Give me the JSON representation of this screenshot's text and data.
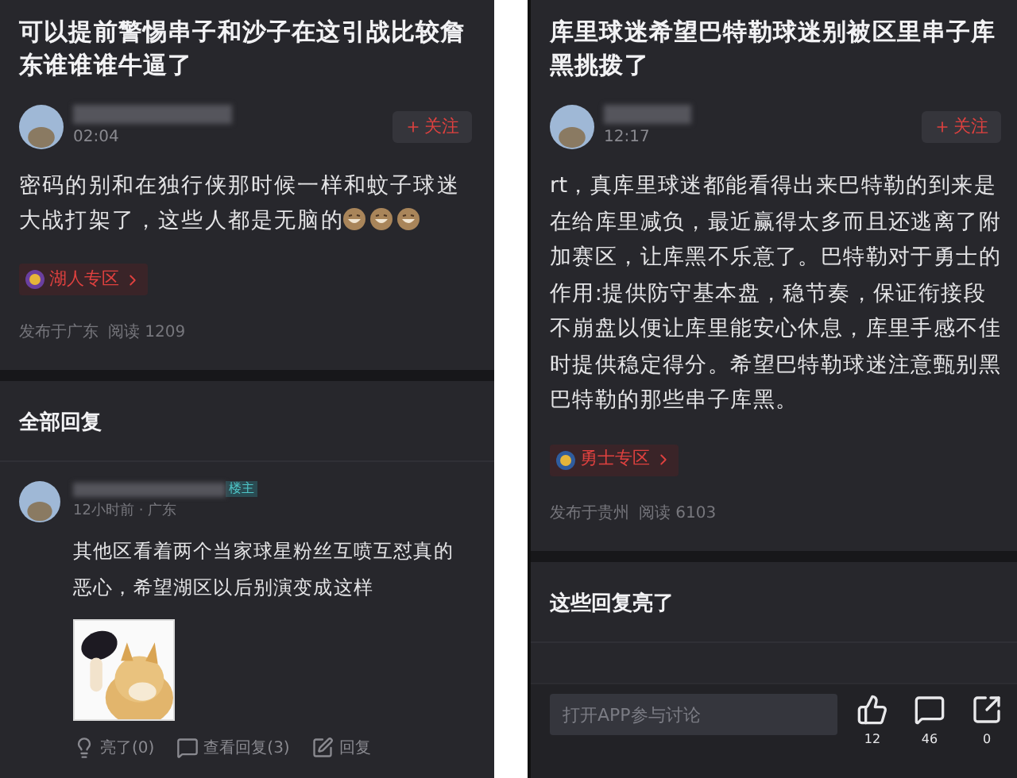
{
  "panels": [
    {
      "title": "可以提前警惕串子和沙子在这引战比较詹东谁谁谁牛逼了",
      "author": {
        "time": "02:04",
        "follow_button": "关注"
      },
      "body": "密码的别和在独行侠那时候一样和蚊子球迷大战打架了，这些人都是无脑的",
      "zone_tag": "湖人专区",
      "meta": [
        "发布于广东",
        "阅读 1209"
      ],
      "section_title": "全部回复",
      "replies": [
        {
          "time": "12小时前 · 广东",
          "badge": "楼主",
          "text": "其他区看着两个当家球星粉丝互喷互怼真的恶心，希望湖区以后别演变成这样",
          "actions": [
            {
              "kind": "light",
              "label": "亮了(0)"
            },
            {
              "kind": "comments",
              "label": "查看回复(3)"
            },
            {
              "kind": "reply",
              "label": "回复"
            }
          ]
        }
      ]
    },
    {
      "title": "库里球迷希望巴特勒球迷别被区里串子库黑挑拨了",
      "author": {
        "time": "12:17",
        "follow_button": "关注"
      },
      "body": "rt，真库里球迷都能看得出来巴特勒的到来是在给库里减负，最近赢得太多而且还逃离了附加赛区，让库黑不乐意了。巴特勒对于勇士的作用:提供防守基本盘，稳节奏，保证衔接段不崩盘以便让库里能安心休息，库里手感不佳时提供稳定得分。希望巴特勒球迷注意甄别黑巴特勒的那些串子库黑。",
      "zone_tag": "勇士专区",
      "meta": [
        "发布于贵州",
        "阅读 6103"
      ],
      "section_title": "这些回复亮了",
      "bottom_bar": {
        "placeholder": "打开APP参与讨论",
        "buttons": [
          {
            "kind": "like",
            "count": "12"
          },
          {
            "kind": "comment",
            "count": "46"
          },
          {
            "kind": "share",
            "count": "0"
          }
        ]
      }
    }
  ]
}
